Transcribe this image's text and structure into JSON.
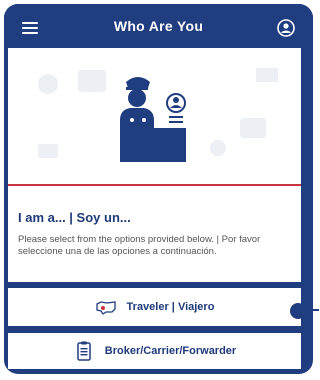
{
  "header": {
    "title": "Who Are You",
    "menu_icon": "hamburger-menu-icon",
    "profile_icon": "user-circle-icon"
  },
  "intro": {
    "heading": "I am a... | Soy un...",
    "description": "Please select from the options provided below. | Por favor seleccione una de las opciones a continuación."
  },
  "options": [
    {
      "label": "Traveler | Viajero",
      "icon": "us-map-pin-icon"
    },
    {
      "label": "Broker/Carrier/Forwarder",
      "icon": "clipboard-document-icon"
    }
  ],
  "colors": {
    "primary": "#1f3d7f",
    "accent_red": "#c9323f",
    "text_dark": "#1e3a78"
  }
}
